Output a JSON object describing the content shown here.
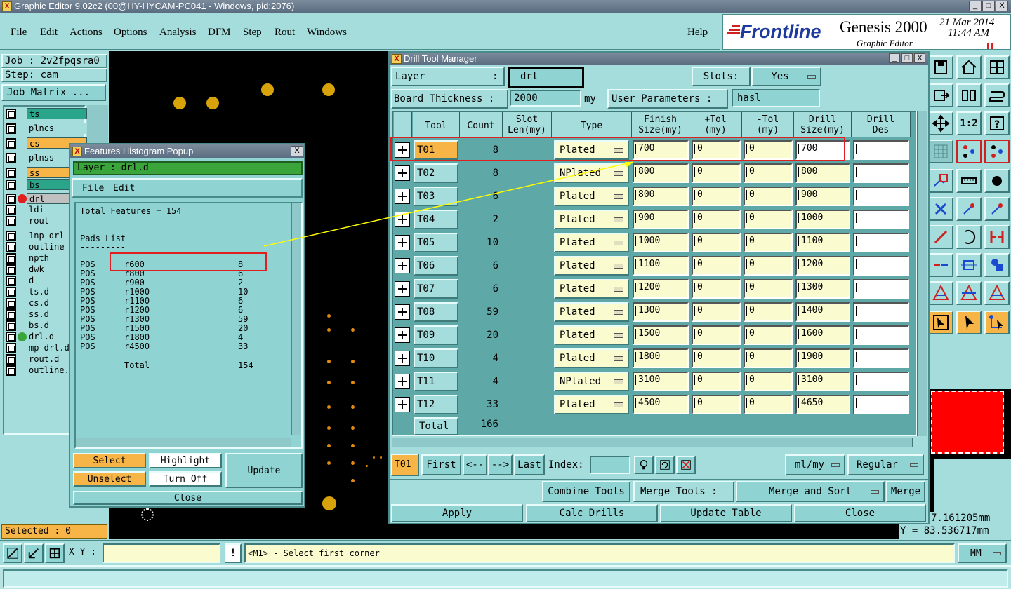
{
  "window": {
    "title": "Graphic Editor 9.02c2 (00@HY-HYCAM-PC041 - Windows, pid:2076)"
  },
  "menus": [
    "File",
    "Edit",
    "Actions",
    "Options",
    "Analysis",
    "DFM",
    "Step",
    "Rout",
    "Windows"
  ],
  "help_label": "Help",
  "brand": {
    "logo": "Frontline",
    "product": "Genesis 2000",
    "subtitle": "Graphic Editor",
    "date": "21 Mar 2014",
    "time": "11:44 AM"
  },
  "job": {
    "job_label": "Job : 2v2fpqsra0",
    "step_label": "Step: cam",
    "matrix_button": "Job Matrix ..."
  },
  "layers": [
    {
      "name": "ts",
      "color": "#2aa58a"
    },
    {
      "name": "plncs",
      "color": "#a5dcdc"
    },
    {
      "name": "cs",
      "color": "#f7b447"
    },
    {
      "name": "plnss",
      "color": "#a5dcdc"
    },
    {
      "name": "ss",
      "color": "#f7b447"
    },
    {
      "name": "bs",
      "color": "#2aa58a"
    },
    {
      "name": "drl",
      "color": "#c0c0c0",
      "marker": "#e02020"
    },
    {
      "name": "ldi",
      "color": "#a5dcdc"
    },
    {
      "name": "rout",
      "color": "#a5dcdc"
    },
    {
      "name": "1np-drl",
      "color": "#a5dcdc"
    },
    {
      "name": "outline",
      "color": "#a5dcdc"
    },
    {
      "name": "npth",
      "color": "#a5dcdc"
    },
    {
      "name": "dwk",
      "color": "#a5dcdc"
    },
    {
      "name": "d",
      "color": "#a5dcdc"
    },
    {
      "name": "ts.d",
      "color": "#a5dcdc"
    },
    {
      "name": "cs.d",
      "color": "#a5dcdc"
    },
    {
      "name": "ss.d",
      "color": "#a5dcdc"
    },
    {
      "name": "bs.d",
      "color": "#a5dcdc"
    },
    {
      "name": "drl.d",
      "color": "#a5dcdc",
      "marker": "#3aa53a"
    },
    {
      "name": "mp-drl.d",
      "color": "#a5dcdc"
    },
    {
      "name": "rout.d",
      "color": "#a5dcdc"
    },
    {
      "name": "outline.",
      "color": "#a5dcdc"
    }
  ],
  "selected_label": "Selected : 0",
  "histogram": {
    "title": "Features Histogram Popup",
    "layer_label": "Layer :  drl.d",
    "menu_file": "File",
    "menu_edit": "Edit",
    "total_features": "Total Features = 154",
    "pads_list": "Pads List",
    "pads_underline": "---------",
    "rows": [
      {
        "pol": "POS",
        "sym": "r600",
        "count": "8"
      },
      {
        "pol": "POS",
        "sym": "r800",
        "count": "6"
      },
      {
        "pol": "POS",
        "sym": "r900",
        "count": "2"
      },
      {
        "pol": "POS",
        "sym": "r1000",
        "count": "10"
      },
      {
        "pol": "POS",
        "sym": "r1100",
        "count": "6"
      },
      {
        "pol": "POS",
        "sym": "r1200",
        "count": "6"
      },
      {
        "pol": "POS",
        "sym": "r1300",
        "count": "59"
      },
      {
        "pol": "POS",
        "sym": "r1500",
        "count": "20"
      },
      {
        "pol": "POS",
        "sym": "r1800",
        "count": "4"
      },
      {
        "pol": "POS",
        "sym": "r4500",
        "count": "33"
      }
    ],
    "divider": "--------------------------------------",
    "total_label": "Total",
    "total_value": "154",
    "buttons": {
      "select": "Select",
      "highlight": "Highlight",
      "update": "Update",
      "unselect": "Unselect",
      "turn_off": "Turn Off",
      "close": "Close"
    }
  },
  "drill": {
    "title": "Drill Tool Manager",
    "layer_label": "Layer",
    "layer_colon": ":",
    "layer_value": "drl",
    "slots_label": "Slots:",
    "slots_value": "Yes",
    "board_thickness_label": "Board Thickness :",
    "board_thickness_value": "2000",
    "board_thickness_unit": "my",
    "user_params_label": "User Parameters :",
    "user_params_value": "hasl",
    "headers": {
      "tool": "Tool",
      "count": "Count",
      "slot": "Slot\nLen(my)",
      "type": "Type",
      "finish": "Finish\nSize(my)",
      "ptol": "+Tol\n(my)",
      "mtol": "-Tol\n(my)",
      "drill_size": "Drill\nSize(my)",
      "drill_des": "Drill\nDes"
    },
    "tools": [
      {
        "tool": "T01",
        "count": "8",
        "type": "Plated",
        "finish": "700",
        "ptol": "0",
        "mtol": "0",
        "drill": "700",
        "des": ""
      },
      {
        "tool": "T02",
        "count": "8",
        "type": "NPlated",
        "finish": "800",
        "ptol": "0",
        "mtol": "0",
        "drill": "800",
        "des": ""
      },
      {
        "tool": "T03",
        "count": "6",
        "type": "Plated",
        "finish": "800",
        "ptol": "0",
        "mtol": "0",
        "drill": "900",
        "des": ""
      },
      {
        "tool": "T04",
        "count": "2",
        "type": "Plated",
        "finish": "900",
        "ptol": "0",
        "mtol": "0",
        "drill": "1000",
        "des": ""
      },
      {
        "tool": "T05",
        "count": "10",
        "type": "Plated",
        "finish": "1000",
        "ptol": "0",
        "mtol": "0",
        "drill": "1100",
        "des": ""
      },
      {
        "tool": "T06",
        "count": "6",
        "type": "Plated",
        "finish": "1100",
        "ptol": "0",
        "mtol": "0",
        "drill": "1200",
        "des": ""
      },
      {
        "tool": "T07",
        "count": "6",
        "type": "Plated",
        "finish": "1200",
        "ptol": "0",
        "mtol": "0",
        "drill": "1300",
        "des": ""
      },
      {
        "tool": "T08",
        "count": "59",
        "type": "Plated",
        "finish": "1300",
        "ptol": "0",
        "mtol": "0",
        "drill": "1400",
        "des": ""
      },
      {
        "tool": "T09",
        "count": "20",
        "type": "Plated",
        "finish": "1500",
        "ptol": "0",
        "mtol": "0",
        "drill": "1600",
        "des": ""
      },
      {
        "tool": "T10",
        "count": "4",
        "type": "Plated",
        "finish": "1800",
        "ptol": "0",
        "mtol": "0",
        "drill": "1900",
        "des": ""
      },
      {
        "tool": "T11",
        "count": "4",
        "type": "NPlated",
        "finish": "3100",
        "ptol": "0",
        "mtol": "0",
        "drill": "3100",
        "des": ""
      },
      {
        "tool": "T12",
        "count": "33",
        "type": "Plated",
        "finish": "4500",
        "ptol": "0",
        "mtol": "0",
        "drill": "4650",
        "des": ""
      }
    ],
    "total_label": "Total",
    "total_count": "166",
    "nav": {
      "current": "T01",
      "first": "First",
      "prev": "<--",
      "next": "-->",
      "last": "Last",
      "index_label": "Index:",
      "units": "ml/my",
      "mode": "Regular"
    },
    "combine_label": "Combine Tools",
    "merge_tools_label": "Merge Tools :",
    "merge_mode": "Merge and Sort",
    "merge_button": "Merge",
    "apply": "Apply",
    "calc": "Calc Drills",
    "update_table": "Update Table",
    "close": "Close"
  },
  "coords": {
    "x": "7.161205mm",
    "y": "Y = 83.536717mm"
  },
  "statusbar": {
    "xy_label": "X Y :",
    "xy_value": "",
    "message": "<M1> - Select first corner",
    "units": "MM"
  }
}
